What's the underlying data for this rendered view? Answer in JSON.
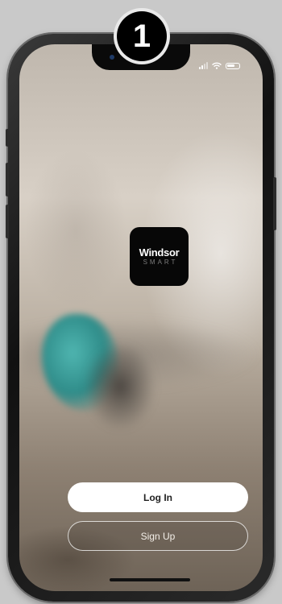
{
  "step_badge": {
    "number": "1"
  },
  "app": {
    "logo": {
      "word": "Windsor",
      "sub": "SMART"
    }
  },
  "buttons": {
    "login_label": "Log In",
    "signup_label": "Sign Up"
  },
  "status_bar": {
    "icons": [
      "cellular-signal-icon",
      "wifi-icon",
      "battery-icon"
    ]
  },
  "colors": {
    "logo_background": "#070707",
    "login_button": "#ffffff",
    "badge": "#000000"
  }
}
